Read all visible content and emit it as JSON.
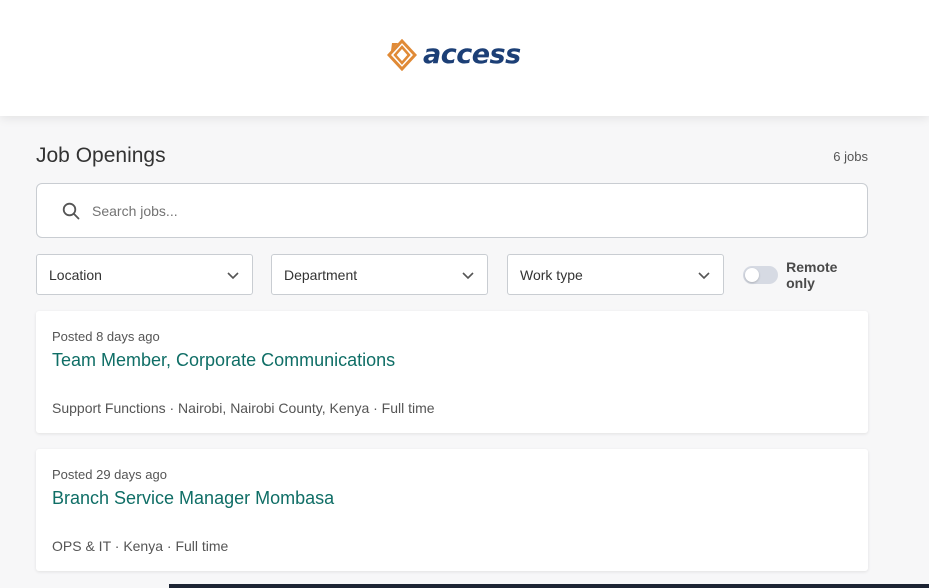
{
  "brand": {
    "name": "access",
    "logo_icon": "diamond-logo-icon",
    "colors": {
      "logo_orange": "#e08a36",
      "logo_text": "#1c3f76"
    }
  },
  "header": {
    "title": "Job Openings",
    "job_count": "6 jobs"
  },
  "search": {
    "icon": "search-icon",
    "placeholder": "Search jobs..."
  },
  "filters": {
    "location": {
      "label": "Location",
      "icon": "chevron-down-icon"
    },
    "department": {
      "label": "Department",
      "icon": "chevron-down-icon"
    },
    "work_type": {
      "label": "Work type",
      "icon": "chevron-down-icon"
    },
    "remote": {
      "label": "Remote only",
      "enabled": false
    }
  },
  "jobs": [
    {
      "posted": "Posted 8 days ago",
      "title": "Team Member, Corporate Communications",
      "meta": "Support Functions · Nairobi, Nairobi County, Kenya · Full time"
    },
    {
      "posted": "Posted 29 days ago",
      "title": "Branch Service Manager Mombasa",
      "meta": "OPS & IT · Kenya · Full time"
    }
  ],
  "colors": {
    "accent_title": "#0f6e66",
    "page_bg": "#f7f7f8"
  }
}
